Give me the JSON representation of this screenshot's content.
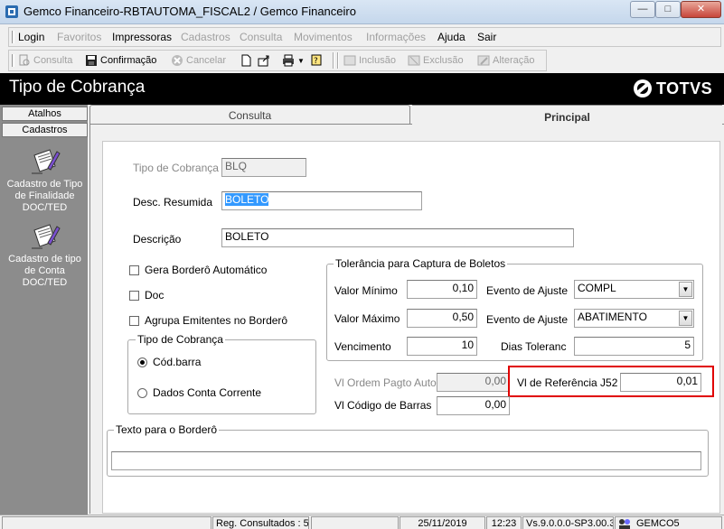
{
  "window": {
    "title": "Gemco Financeiro-RBTAUTOMA_FISCAL2 / Gemco Financeiro"
  },
  "menu": {
    "items": [
      {
        "label": "Login",
        "enabled": true
      },
      {
        "label": "Favoritos",
        "enabled": false
      },
      {
        "label": "Impressoras",
        "enabled": true
      },
      {
        "label": "Cadastros",
        "enabled": false
      },
      {
        "label": "Consulta",
        "enabled": false
      },
      {
        "label": "Movimentos",
        "enabled": false
      },
      {
        "label": "Informações",
        "enabled": false
      },
      {
        "label": "Ajuda",
        "enabled": true
      },
      {
        "label": "Sair",
        "enabled": true
      }
    ]
  },
  "toolbar": {
    "consulta": "Consulta",
    "confirmacao": "Confirmação",
    "cancelar": "Cancelar",
    "inclusao": "Inclusão",
    "exclusao": "Exclusão",
    "alteracao": "Alteração"
  },
  "header": {
    "title": "Tipo de Cobrança",
    "logo": "TOTVS"
  },
  "sidebar": {
    "atalhos": "Atalhos",
    "cadastros": "Cadastros",
    "items": [
      {
        "label": "Cadastro de Tipo de Finalidade DOC/TED",
        "icon": "document-pen-icon"
      },
      {
        "label": "Cadastro de tipo de Conta DOC/TED",
        "icon": "document-pen-icon"
      }
    ]
  },
  "tabs": {
    "consulta": "Consulta",
    "principal": "Principal"
  },
  "form": {
    "tipo_cobranca_label": "Tipo de Cobrança",
    "tipo_cobranca_value": "BLQ",
    "desc_resumida_label": "Desc. Resumida",
    "desc_resumida_value": "BOLETO",
    "descricao_label": "Descrição",
    "descricao_value": "BOLETO",
    "gera_bordero_label": "Gera Borderô Automático",
    "doc_label": "Doc",
    "agrupa_label": "Agrupa Emitentes no Borderô",
    "tipo_group_title": "Tipo de Cobrança",
    "radio_codbarra": "Cód.barra",
    "radio_dados_conta": "Dados Conta Corrente",
    "tolerancia_title": "Tolerância para Captura de Boletos",
    "valor_minimo_label": "Valor Mínimo",
    "valor_minimo_value": "0,10",
    "evento_ajuste_label_1": "Evento de Ajuste",
    "evento_ajuste_value_1": "COMPL",
    "valor_maximo_label": "Valor Máximo",
    "valor_maximo_value": "0,50",
    "evento_ajuste_label_2": "Evento de Ajuste",
    "evento_ajuste_value_2": "ABATIMENTO",
    "vencimento_label": "Vencimento",
    "vencimento_value": "10",
    "dias_tolerancia_label": "Dias Toleranc",
    "dias_tolerancia_value": "5",
    "vl_ordem_label": "Vl Ordem Pagto Auto",
    "vl_ordem_value": "0,00",
    "vl_referencia_label": "Vl de Referência J52",
    "vl_referencia_value": "0,01",
    "vl_codigo_label": "Vl Código de Barras",
    "vl_codigo_value": "0,00",
    "texto_bordero_title": "Texto para o Borderô",
    "texto_bordero_value": ""
  },
  "statusbar": {
    "reg_consultados": "Reg. Consultados : 5",
    "date": "25/11/2019",
    "time": "12:23",
    "version": "Vs.9.0.0.0-SP3.00.3",
    "user": "GEMCO5"
  },
  "colors": {
    "header_bg": "#000000",
    "sidebar_bg": "#8c8c8c",
    "highlight_border": "#e00000",
    "selection": "#3399ff"
  }
}
